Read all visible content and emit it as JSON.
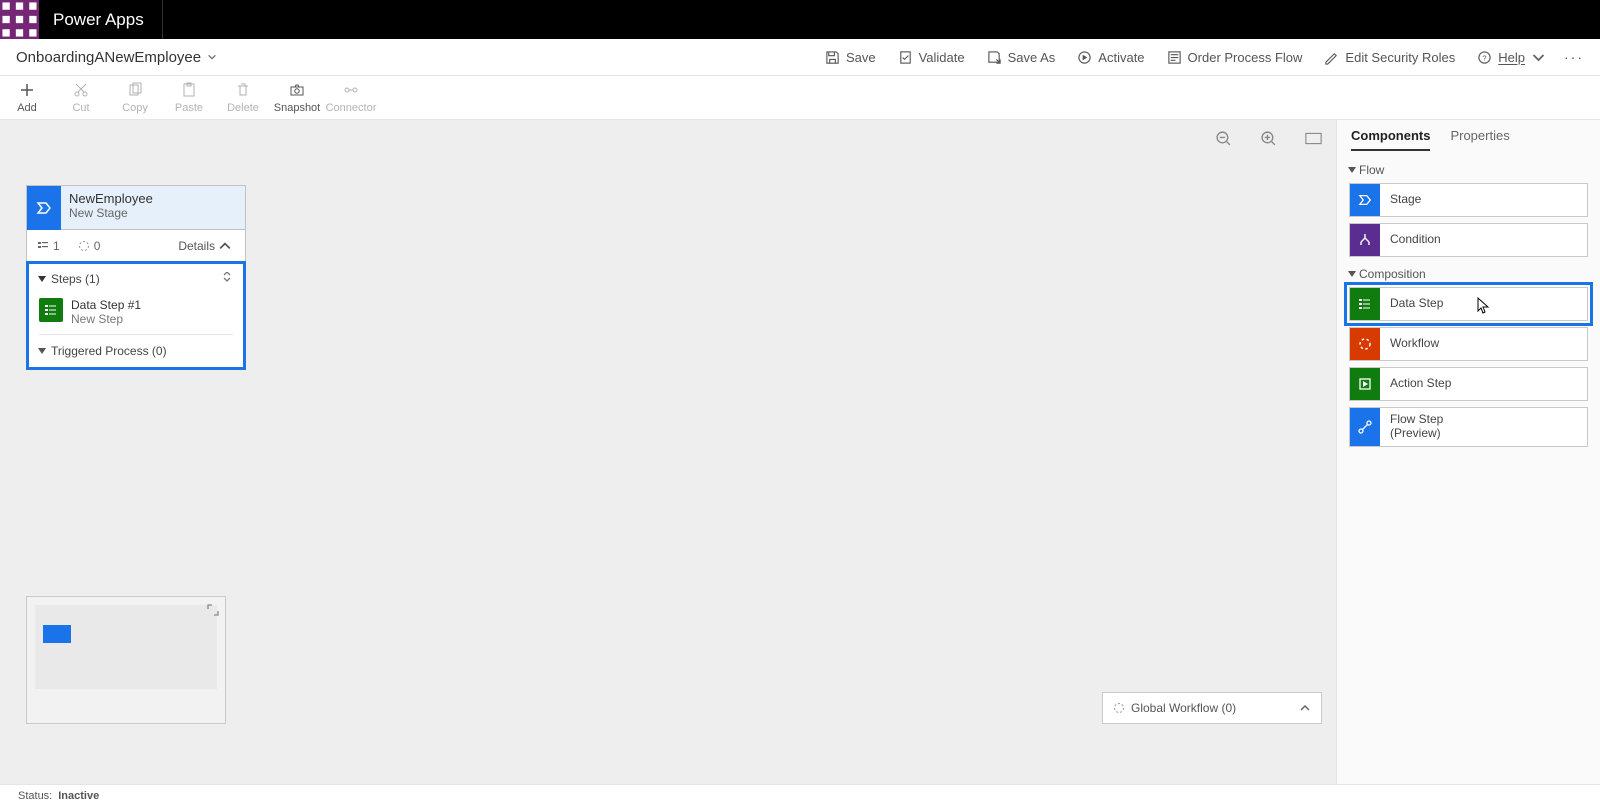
{
  "app": {
    "brand": "Power Apps"
  },
  "flow": {
    "name": "OnboardingANewEmployee"
  },
  "headerCmds": {
    "save": "Save",
    "validate": "Validate",
    "saveAs": "Save As",
    "activate": "Activate",
    "orderFlow": "Order Process Flow",
    "editSecurity": "Edit Security Roles",
    "help": "Help"
  },
  "ribbon": {
    "add": "Add",
    "cut": "Cut",
    "copy": "Copy",
    "paste": "Paste",
    "delete": "Delete",
    "snapshot": "Snapshot",
    "connector": "Connector"
  },
  "stage": {
    "title": "NewEmployee",
    "subtitle": "New Stage",
    "stepsCount": "1",
    "workflowCount": "0",
    "detailsLabel": "Details",
    "stepsLabel": "Steps (1)",
    "dataStepTitle": "Data Step #1",
    "dataStepSub": "New Step",
    "triggeredLabel": "Triggered Process (0)"
  },
  "globalWorkflow": {
    "label": "Global Workflow (0)"
  },
  "rightPane": {
    "tabs": {
      "components": "Components",
      "properties": "Properties"
    },
    "sections": {
      "flow": "Flow",
      "composition": "Composition"
    },
    "items": {
      "stage": "Stage",
      "condition": "Condition",
      "dataStep": "Data Step",
      "workflow": "Workflow",
      "actionStep": "Action Step",
      "flowStep": "Flow Step\n(Preview)"
    }
  },
  "status": {
    "label": "Status:",
    "value": "Inactive"
  }
}
